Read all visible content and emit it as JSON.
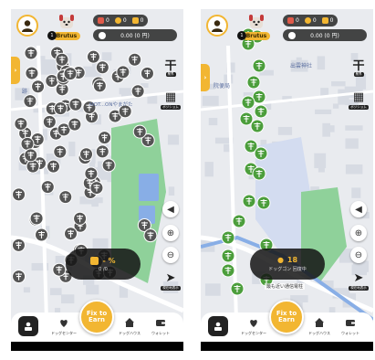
{
  "colors": {
    "accent": "#f2b632",
    "map_bg": "#e9ebef",
    "park": "#8fd19a",
    "water": "#88aee6",
    "pin_gray": "#555555",
    "pin_green": "#4c9e3c"
  },
  "left_screen": {
    "top_bar": {
      "pet_name": "Brutus",
      "pet_level": "1",
      "counters": [
        {
          "icon": "camera-ticket-icon",
          "value": "0",
          "color": "#e05a4a"
        },
        {
          "icon": "energy-icon",
          "value": "0",
          "color": "#f2b632"
        },
        {
          "icon": "key-icon",
          "value": "0",
          "color": "#f2b632"
        }
      ],
      "balance": "0.00 (0 円)"
    },
    "map_labels": [
      "跡",
      "MOT...ONやまがた"
    ],
    "side_buttons": {
      "nearby_label": "業界",
      "gps_label": "ポジショム"
    },
    "rate_pill": {
      "value": "- %",
      "sub": "0 /0"
    },
    "fix_button": "Fix to\nEarn",
    "nav": [
      {
        "icon": "dog-center-icon",
        "label": "ドッグセンター"
      },
      {
        "icon": "dog-house-icon",
        "label": "ドッグハウス"
      },
      {
        "icon": "wallet-icon",
        "label": "ウォレット"
      }
    ],
    "locate_label": "現在地表示"
  },
  "right_screen": {
    "top_bar": {
      "pet_name": "Brutus",
      "pet_level": "1",
      "counters": [
        {
          "icon": "camera-ticket-icon",
          "value": "0",
          "color": "#e05a4a"
        },
        {
          "icon": "energy-icon",
          "value": "0",
          "color": "#f2b632"
        },
        {
          "icon": "key-icon",
          "value": "0",
          "color": "#f2b632"
        }
      ],
      "balance": "0.00 (0 円)"
    },
    "map_labels": [
      "出雲神社",
      "院便局"
    ],
    "side_buttons": {
      "nearby_label": "業界",
      "gps_label": "ポジショム"
    },
    "rate_pill": {
      "value": "18",
      "sub": "ドッグゴン 回復中"
    },
    "selected_label": "最も近い通信電柱",
    "fix_button": "Fix to\nEarn",
    "nav": [
      {
        "icon": "dog-center-icon",
        "label": "ドッグセンター"
      },
      {
        "icon": "dog-house-icon",
        "label": "ドッグハウス"
      },
      {
        "icon": "wallet-icon",
        "label": "ウォレット"
      }
    ],
    "locate_label": "現在地表示"
  }
}
